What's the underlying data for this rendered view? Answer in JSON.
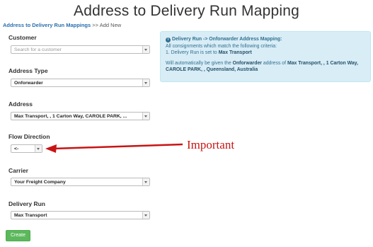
{
  "page_title": "Address to Delivery Run Mapping",
  "breadcrumb": {
    "link": "Address to Delivery Run Mappings",
    "separator": " >> ",
    "current": "Add New"
  },
  "fields": {
    "customer": {
      "label": "Customer",
      "placeholder": "Search for a customer"
    },
    "address_type": {
      "label": "Address Type",
      "value": "Onforwarder"
    },
    "address": {
      "label": "Address",
      "value": "Max Transport, , 1 Carton Way, CAROLE PARK, ..."
    },
    "flow_direction": {
      "label": "Flow Direction",
      "value": "<-"
    },
    "carrier": {
      "label": "Carrier",
      "value": "Your Freight Company"
    },
    "delivery_run": {
      "label": "Delivery Run",
      "value": "Max Transport"
    }
  },
  "info_box": {
    "icon": "i",
    "heading": "Delivery Run -> Onforwarder Address Mapping:",
    "line1": "All consignments which match the following criteria:",
    "criteria_prefix": "1.  Delivery Run is set to ",
    "criteria_value": "Max Transport",
    "result_prefix": "Will automatically be given the ",
    "result_bold": "Onforwarder",
    "result_mid": " address of ",
    "result_address": "Max Transport, , 1 Carton Way, CAROLE PARK, , Queensland, Australia"
  },
  "create_button": "Create",
  "annotation": {
    "text": "Important",
    "color": "#c81414"
  },
  "colors": {
    "info_bg": "#d9edf7",
    "button_green": "#5cb85c",
    "link_blue": "#2a6fb0"
  }
}
